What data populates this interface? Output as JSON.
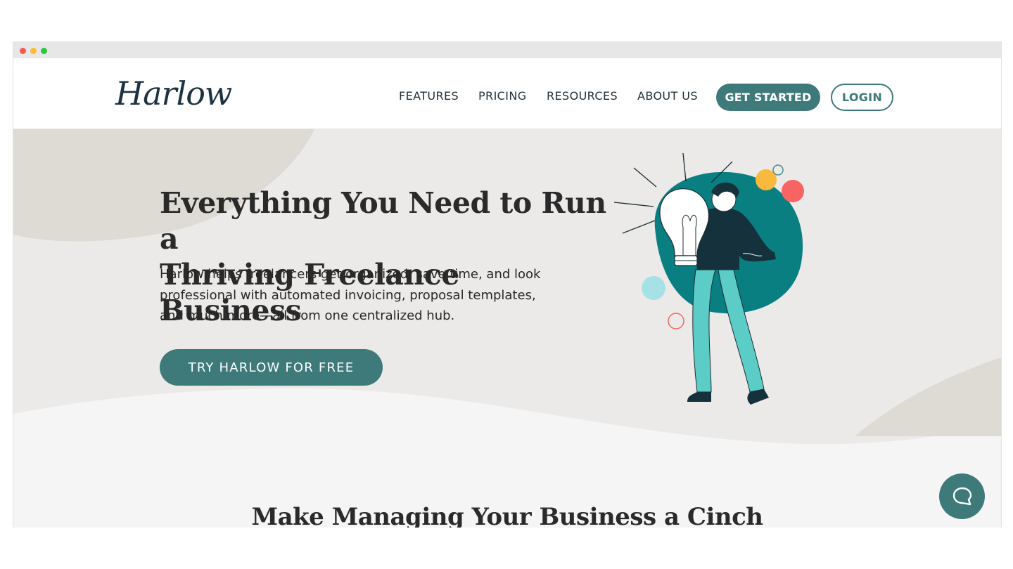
{
  "header": {
    "logo_text": "Harlow",
    "nav": [
      "FEATURES",
      "PRICING",
      "RESOURCES",
      "ABOUT US"
    ],
    "get_started": "GET STARTED",
    "login": "LOGIN"
  },
  "hero": {
    "title_line1": "Everything You Need to Run a",
    "title_line2": "Thriving Freelance Business",
    "sub_line1": "Harlow helps freelancers get organized, save time, and look",
    "sub_line2": "professional with automated invoicing, proposal templates,",
    "sub_line3": "and much more—all from one centralized hub.",
    "cta": "TRY HARLOW FOR FREE"
  },
  "section": {
    "title": "Make Managing Your Business a Cinch"
  },
  "colors": {
    "teal": "#3f7a7b",
    "dark_teal": "#0a7f82",
    "hero_bg": "#ebeae8",
    "blob": "#dedbd4"
  },
  "icons": {
    "chat": "chat-bubble-icon",
    "window_controls": [
      "close-dot",
      "minimize-dot",
      "maximize-dot"
    ]
  }
}
